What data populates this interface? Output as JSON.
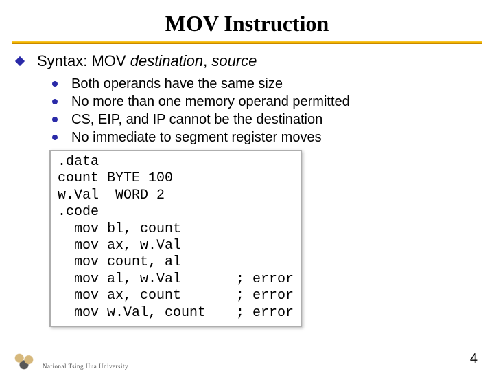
{
  "title": "MOV Instruction",
  "main_bullet": {
    "prefix": "Syntax: MOV ",
    "dest": "destination",
    "sep": ", ",
    "src": "source"
  },
  "sub_bullets": [
    "Both operands have the same size",
    "No more than one memory operand permitted",
    "CS, EIP, and IP cannot be the destination",
    "No immediate to segment register moves"
  ],
  "code": {
    "head": [
      ".data",
      "count BYTE 100",
      "w.Val  WORD 2",
      ".code"
    ],
    "rows": [
      {
        "lhs": "  mov bl, count",
        "rhs": ""
      },
      {
        "lhs": "  mov ax, w.Val",
        "rhs": ""
      },
      {
        "lhs": "  mov count, al",
        "rhs": ""
      },
      {
        "lhs": "  mov al, w.Val",
        "rhs": "; error"
      },
      {
        "lhs": "  mov ax, count",
        "rhs": "; error"
      },
      {
        "lhs": "  mov w.Val, count",
        "rhs": "; error"
      }
    ]
  },
  "footer": "National Tsing Hua University",
  "page_number": "4"
}
